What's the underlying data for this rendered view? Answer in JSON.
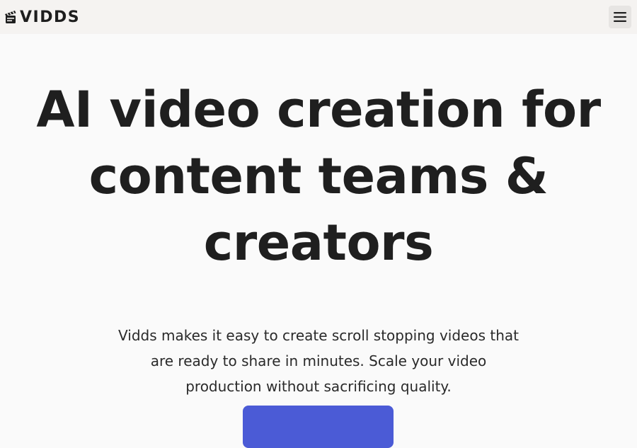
{
  "header": {
    "brand_name": "VIDDS",
    "logo_icon": "clapperboard-icon",
    "menu_icon": "hamburger-menu-icon"
  },
  "hero": {
    "title_line1": "AI video creation for",
    "title_line2": "content teams &",
    "title_line3": "creators",
    "subtitle_line1": "Vidds makes it easy to create scroll stopping videos that",
    "subtitle_line2": "are ready to share in minutes. Scale your video",
    "subtitle_line3": "production without sacrificing quality.",
    "cta_label": ""
  },
  "colors": {
    "header_bg": "#f5f3f1",
    "page_bg": "#fafafa",
    "accent": "#4b5bd6",
    "text": "#1f1f1f"
  }
}
